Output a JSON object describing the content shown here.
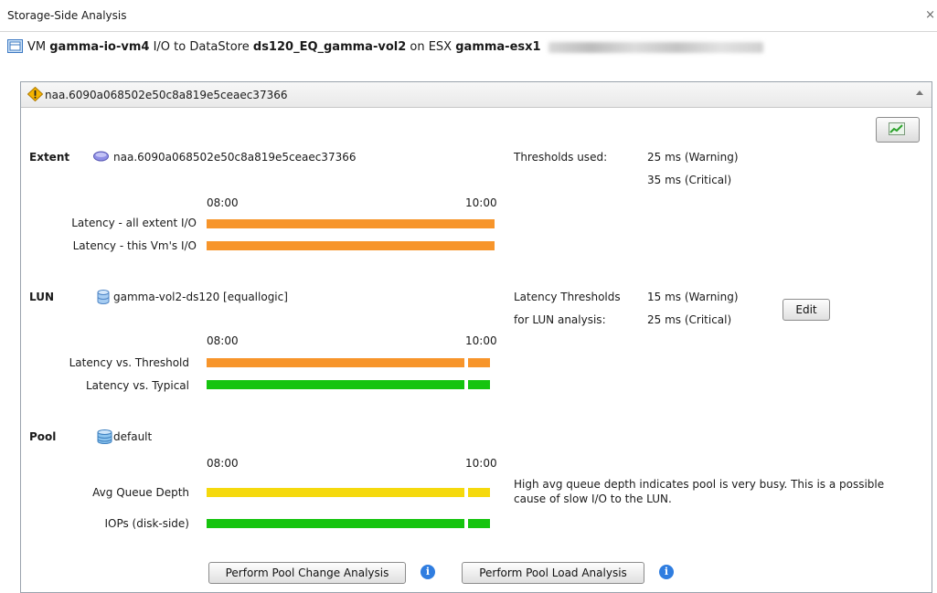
{
  "window": {
    "title": "Storage-Side Analysis",
    "close": "×"
  },
  "vm_line": {
    "p1": "VM",
    "vm": "gamma-io-vm4",
    "p2": "I/O to DataStore",
    "datastore": "ds120_EQ_gamma-vol2",
    "p3": "on ESX",
    "esx": "gamma-esx1"
  },
  "panel": {
    "header": "naa.6090a068502e50c8a819e5ceaec37366",
    "extent": {
      "title": "Extent",
      "name": "naa.6090a068502e50c8a819e5ceaec37366",
      "time_start": "08:00",
      "time_end": "10:00",
      "rows": [
        "Latency - all extent I/O",
        "Latency - this Vm's I/O"
      ],
      "thresholds_label": "Thresholds used:",
      "warning": "25 ms (Warning)",
      "critical": "35 ms (Critical)"
    },
    "lun": {
      "title": "LUN",
      "name": "gamma-vol2-ds120 [equallogic]",
      "time_start": "08:00",
      "time_end": "10:00",
      "rows": [
        "Latency vs. Threshold",
        "Latency vs. Typical"
      ],
      "thresholds_label1": "Latency Thresholds",
      "thresholds_label2": "for LUN analysis:",
      "warning": "15 ms (Warning)",
      "critical": "25 ms (Critical)",
      "edit_button": "Edit"
    },
    "pool": {
      "title": "Pool",
      "name": "default",
      "time_start": "08:00",
      "time_end": "10:00",
      "rows": [
        "Avg Queue Depth",
        "IOPs (disk-side)"
      ],
      "message_line1": "High avg queue depth indicates pool is very busy. This is a possible",
      "message_line2": "cause of slow I/O to the LUN."
    },
    "buttons": {
      "pool_change": "Perform Pool Change Analysis",
      "pool_load": "Perform Pool Load Analysis",
      "info": "i"
    }
  },
  "colors": {
    "orange": "#f7952b",
    "green": "#16c40f",
    "yellow": "#f5d90d",
    "info": "#2f7de0"
  }
}
